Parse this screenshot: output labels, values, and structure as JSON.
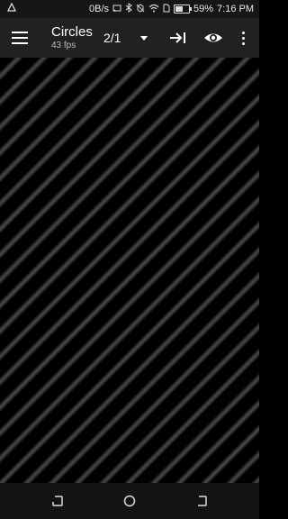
{
  "status_bar": {
    "left_icon": "triangle-icon",
    "speed": "0B/s",
    "icons": [
      "cast-icon",
      "bluetooth-icon",
      "silent-icon",
      "wifi-icon",
      "sim-icon"
    ],
    "battery_percent": "59%",
    "battery_level": 0.59,
    "time": "7:16 PM"
  },
  "app_bar": {
    "title": "Circles",
    "fps": "43 fps",
    "spinner_value": "2/1",
    "actions": [
      "menu-icon",
      "skip-to-end-icon",
      "eye-icon",
      "more-vert-icon"
    ]
  },
  "canvas": {
    "pattern": "diagonal-stripes"
  },
  "nav_bar": {
    "buttons": [
      "back-icon",
      "home-icon",
      "recents-icon"
    ]
  }
}
